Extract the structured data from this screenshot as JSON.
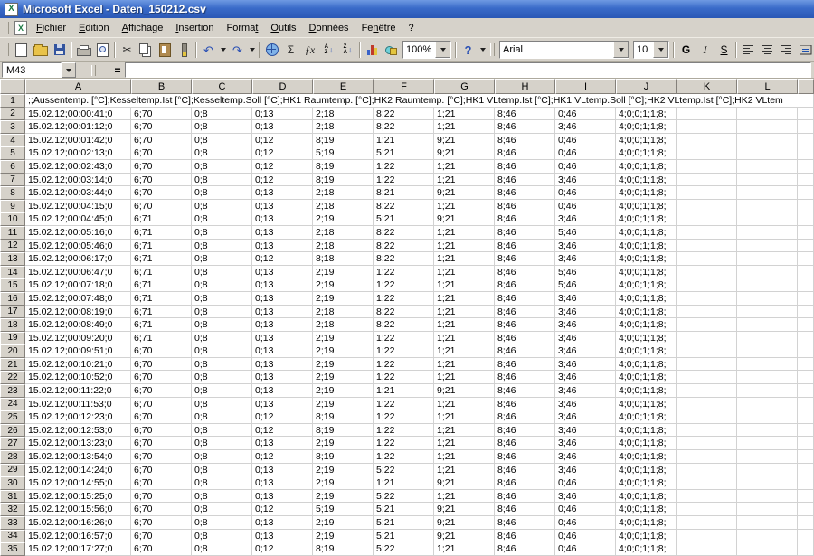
{
  "window": {
    "title": "Microsoft Excel - Daten_150212.csv"
  },
  "menu": {
    "items": [
      {
        "label": "Fichier",
        "accel": 0
      },
      {
        "label": "Edition",
        "accel": 0
      },
      {
        "label": "Affichage",
        "accel": 0
      },
      {
        "label": "Insertion",
        "accel": 0
      },
      {
        "label": "Format",
        "accel": 5
      },
      {
        "label": "Outils",
        "accel": 0
      },
      {
        "label": "Données",
        "accel": 0
      },
      {
        "label": "Fenêtre",
        "accel": 2
      },
      {
        "label": "?",
        "accel": -1
      }
    ]
  },
  "toolbar": {
    "zoom": "100%",
    "help_label": "?",
    "font_name": "Arial",
    "font_size": "10",
    "bold_label": "G",
    "italic_label": "I",
    "underline_label": "S",
    "icons": {
      "cut": "✂",
      "undo": "↶",
      "redo": "↷",
      "autosum": "Σ",
      "fx": "ƒx"
    }
  },
  "formula_bar": {
    "name_box": "M43",
    "equals_label": "="
  },
  "sheet": {
    "columns": [
      "A",
      "B",
      "C",
      "D",
      "E",
      "F",
      "G",
      "H",
      "I",
      "J",
      "K",
      "L"
    ],
    "header_row": ";;Aussentemp. [°C];Kesseltemp.Ist [°C];Kesseltemp.Soll [°C];HK1 Raumtemp. [°C];HK2 Raumtemp. [°C];HK1 VLtemp.Ist [°C];HK1 VLtemp.Soll [°C];HK2 VLtemp.Ist [°C];HK2 VLtem",
    "rows": [
      {
        "n": 2,
        "cells": [
          "15.02.12;00:00:41;0",
          "6;70",
          "0;8",
          "0;13",
          "2;18",
          "8;22",
          "1;21",
          "8;46",
          "0;46",
          "4;0;0;1;1;8;"
        ]
      },
      {
        "n": 3,
        "cells": [
          "15.02.12;00:01:12;0",
          "6;70",
          "0;8",
          "0;13",
          "2;18",
          "8;22",
          "1;21",
          "8;46",
          "3;46",
          "4;0;0;1;1;8;"
        ]
      },
      {
        "n": 4,
        "cells": [
          "15.02.12;00:01:42;0",
          "6;70",
          "0;8",
          "0;12",
          "8;19",
          "1;21",
          "9;21",
          "8;46",
          "0;46",
          "4;0;0;1;1;8;"
        ]
      },
      {
        "n": 5,
        "cells": [
          "15.02.12;00:02:13;0",
          "6;70",
          "0;8",
          "0;12",
          "5;19",
          "5;21",
          "9;21",
          "8;46",
          "0;46",
          "4;0;0;1;1;8;"
        ]
      },
      {
        "n": 6,
        "cells": [
          "15.02.12;00:02:43;0",
          "6;70",
          "0;8",
          "0;12",
          "8;19",
          "1;22",
          "1;21",
          "8;46",
          "0;46",
          "4;0;0;1;1;8;"
        ]
      },
      {
        "n": 7,
        "cells": [
          "15.02.12;00:03:14;0",
          "6;70",
          "0;8",
          "0;12",
          "8;19",
          "1;22",
          "1;21",
          "8;46",
          "3;46",
          "4;0;0;1;1;8;"
        ]
      },
      {
        "n": 8,
        "cells": [
          "15.02.12;00:03:44;0",
          "6;70",
          "0;8",
          "0;13",
          "2;18",
          "8;21",
          "9;21",
          "8;46",
          "0;46",
          "4;0;0;1;1;8;"
        ]
      },
      {
        "n": 9,
        "cells": [
          "15.02.12;00:04:15;0",
          "6;70",
          "0;8",
          "0;13",
          "2;18",
          "8;22",
          "1;21",
          "8;46",
          "0;46",
          "4;0;0;1;1;8;"
        ]
      },
      {
        "n": 10,
        "cells": [
          "15.02.12;00:04:45;0",
          "6;71",
          "0;8",
          "0;13",
          "2;19",
          "5;21",
          "9;21",
          "8;46",
          "3;46",
          "4;0;0;1;1;8;"
        ]
      },
      {
        "n": 11,
        "cells": [
          "15.02.12;00:05:16;0",
          "6;71",
          "0;8",
          "0;13",
          "2;18",
          "8;22",
          "1;21",
          "8;46",
          "5;46",
          "4;0;0;1;1;8;"
        ]
      },
      {
        "n": 12,
        "cells": [
          "15.02.12;00:05:46;0",
          "6;71",
          "0;8",
          "0;13",
          "2;18",
          "8;22",
          "1;21",
          "8;46",
          "3;46",
          "4;0;0;1;1;8;"
        ]
      },
      {
        "n": 13,
        "cells": [
          "15.02.12;00:06:17;0",
          "6;71",
          "0;8",
          "0;12",
          "8;18",
          "8;22",
          "1;21",
          "8;46",
          "3;46",
          "4;0;0;1;1;8;"
        ]
      },
      {
        "n": 14,
        "cells": [
          "15.02.12;00:06:47;0",
          "6;71",
          "0;8",
          "0;13",
          "2;19",
          "1;22",
          "1;21",
          "8;46",
          "5;46",
          "4;0;0;1;1;8;"
        ]
      },
      {
        "n": 15,
        "cells": [
          "15.02.12;00:07:18;0",
          "6;71",
          "0;8",
          "0;13",
          "2;19",
          "1;22",
          "1;21",
          "8;46",
          "5;46",
          "4;0;0;1;1;8;"
        ]
      },
      {
        "n": 16,
        "cells": [
          "15.02.12;00:07:48;0",
          "6;71",
          "0;8",
          "0;13",
          "2;19",
          "1;22",
          "1;21",
          "8;46",
          "3;46",
          "4;0;0;1;1;8;"
        ]
      },
      {
        "n": 17,
        "cells": [
          "15.02.12;00:08:19;0",
          "6;71",
          "0;8",
          "0;13",
          "2;18",
          "8;22",
          "1;21",
          "8;46",
          "3;46",
          "4;0;0;1;1;8;"
        ]
      },
      {
        "n": 18,
        "cells": [
          "15.02.12;00:08:49;0",
          "6;71",
          "0;8",
          "0;13",
          "2;18",
          "8;22",
          "1;21",
          "8;46",
          "3;46",
          "4;0;0;1;1;8;"
        ]
      },
      {
        "n": 19,
        "cells": [
          "15.02.12;00:09:20;0",
          "6;71",
          "0;8",
          "0;13",
          "2;19",
          "1;22",
          "1;21",
          "8;46",
          "3;46",
          "4;0;0;1;1;8;"
        ]
      },
      {
        "n": 20,
        "cells": [
          "15.02.12;00:09:51;0",
          "6;70",
          "0;8",
          "0;13",
          "2;19",
          "1;22",
          "1;21",
          "8;46",
          "3;46",
          "4;0;0;1;1;8;"
        ]
      },
      {
        "n": 21,
        "cells": [
          "15.02.12;00:10:21;0",
          "6;70",
          "0;8",
          "0;13",
          "2;19",
          "1;22",
          "1;21",
          "8;46",
          "3;46",
          "4;0;0;1;1;8;"
        ]
      },
      {
        "n": 22,
        "cells": [
          "15.02.12;00:10:52;0",
          "6;70",
          "0;8",
          "0;13",
          "2;19",
          "1;22",
          "1;21",
          "8;46",
          "3;46",
          "4;0;0;1;1;8;"
        ]
      },
      {
        "n": 23,
        "cells": [
          "15.02.12;00:11:22;0",
          "6;70",
          "0;8",
          "0;13",
          "2;19",
          "1;21",
          "9;21",
          "8;46",
          "3;46",
          "4;0;0;1;1;8;"
        ]
      },
      {
        "n": 24,
        "cells": [
          "15.02.12;00:11:53;0",
          "6;70",
          "0;8",
          "0;13",
          "2;19",
          "1;22",
          "1;21",
          "8;46",
          "3;46",
          "4;0;0;1;1;8;"
        ]
      },
      {
        "n": 25,
        "cells": [
          "15.02.12;00:12:23;0",
          "6;70",
          "0;8",
          "0;12",
          "8;19",
          "1;22",
          "1;21",
          "8;46",
          "3;46",
          "4;0;0;1;1;8;"
        ]
      },
      {
        "n": 26,
        "cells": [
          "15.02.12;00:12:53;0",
          "6;70",
          "0;8",
          "0;12",
          "8;19",
          "1;22",
          "1;21",
          "8;46",
          "3;46",
          "4;0;0;1;1;8;"
        ]
      },
      {
        "n": 27,
        "cells": [
          "15.02.12;00:13:23;0",
          "6;70",
          "0;8",
          "0;13",
          "2;19",
          "1;22",
          "1;21",
          "8;46",
          "3;46",
          "4;0;0;1;1;8;"
        ]
      },
      {
        "n": 28,
        "cells": [
          "15.02.12;00:13:54;0",
          "6;70",
          "0;8",
          "0;12",
          "8;19",
          "1;22",
          "1;21",
          "8;46",
          "3;46",
          "4;0;0;1;1;8;"
        ]
      },
      {
        "n": 29,
        "cells": [
          "15.02.12;00:14:24;0",
          "6;70",
          "0;8",
          "0;13",
          "2;19",
          "5;22",
          "1;21",
          "8;46",
          "3;46",
          "4;0;0;1;1;8;"
        ]
      },
      {
        "n": 30,
        "cells": [
          "15.02.12;00:14:55;0",
          "6;70",
          "0;8",
          "0;13",
          "2;19",
          "1;21",
          "9;21",
          "8;46",
          "0;46",
          "4;0;0;1;1;8;"
        ]
      },
      {
        "n": 31,
        "cells": [
          "15.02.12;00:15:25;0",
          "6;70",
          "0;8",
          "0;13",
          "2;19",
          "5;22",
          "1;21",
          "8;46",
          "3;46",
          "4;0;0;1;1;8;"
        ]
      },
      {
        "n": 32,
        "cells": [
          "15.02.12;00:15:56;0",
          "6;70",
          "0;8",
          "0;12",
          "5;19",
          "5;21",
          "9;21",
          "8;46",
          "0;46",
          "4;0;0;1;1;8;"
        ]
      },
      {
        "n": 33,
        "cells": [
          "15.02.12;00:16:26;0",
          "6;70",
          "0;8",
          "0;13",
          "2;19",
          "5;21",
          "9;21",
          "8;46",
          "0;46",
          "4;0;0;1;1;8;"
        ]
      },
      {
        "n": 34,
        "cells": [
          "15.02.12;00:16:57;0",
          "6;70",
          "0;8",
          "0;13",
          "2;19",
          "5;21",
          "9;21",
          "8;46",
          "0;46",
          "4;0;0;1;1;8;"
        ]
      },
      {
        "n": 35,
        "cells": [
          "15.02.12;00:17:27;0",
          "6;70",
          "0;8",
          "0;12",
          "8;19",
          "5;22",
          "1;21",
          "8;46",
          "0;46",
          "4;0;0;1;1;8;"
        ]
      }
    ]
  }
}
